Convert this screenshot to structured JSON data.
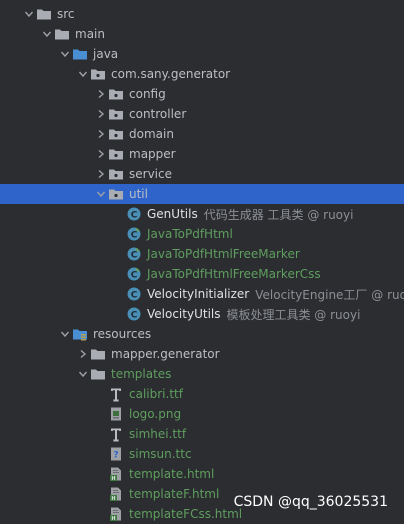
{
  "rows": [
    {
      "id": "src",
      "label": "src",
      "icon": "folder-icon",
      "expanded": true,
      "hasArrow": true,
      "indent": 0
    },
    {
      "id": "main",
      "label": "main",
      "icon": "folder-icon",
      "expanded": true,
      "hasArrow": true,
      "indent": 1
    },
    {
      "id": "java",
      "label": "java",
      "icon": "source-folder-icon",
      "expanded": true,
      "hasArrow": true,
      "indent": 2
    },
    {
      "id": "com-sany-generator",
      "label": "com.sany.generator",
      "icon": "package-icon",
      "expanded": true,
      "hasArrow": true,
      "indent": 3
    },
    {
      "id": "config",
      "label": "config",
      "icon": "package-icon",
      "expanded": false,
      "hasArrow": true,
      "indent": 4
    },
    {
      "id": "controller",
      "label": "controller",
      "icon": "package-icon",
      "expanded": false,
      "hasArrow": true,
      "indent": 4
    },
    {
      "id": "domain",
      "label": "domain",
      "icon": "package-icon",
      "expanded": false,
      "hasArrow": true,
      "indent": 4
    },
    {
      "id": "mapper",
      "label": "mapper",
      "icon": "package-icon",
      "expanded": false,
      "hasArrow": true,
      "indent": 4
    },
    {
      "id": "service",
      "label": "service",
      "icon": "package-icon",
      "expanded": false,
      "hasArrow": true,
      "indent": 4
    },
    {
      "id": "util",
      "label": "util",
      "icon": "package-icon",
      "expanded": true,
      "hasArrow": true,
      "indent": 4,
      "selected": true
    },
    {
      "id": "genutils",
      "label": "GenUtils",
      "desc": "代码生成器 工具类 @ ruoyi",
      "icon": "java-class-icon",
      "hasArrow": false,
      "indent": 5,
      "tone": "white"
    },
    {
      "id": "javatopdfhtml",
      "label": "JavaToPdfHtml",
      "icon": "java-class-new-icon",
      "hasArrow": false,
      "indent": 5,
      "tone": "green"
    },
    {
      "id": "javatopdfhtmlfreemarker",
      "label": "JavaToPdfHtmlFreeMarker",
      "icon": "java-class-new-icon",
      "hasArrow": false,
      "indent": 5,
      "tone": "green"
    },
    {
      "id": "javatopdfhtmlfreemarkercss",
      "label": "JavaToPdfHtmlFreeMarkerCss",
      "icon": "java-class-new-icon",
      "hasArrow": false,
      "indent": 5,
      "tone": "green"
    },
    {
      "id": "velocityinitializer",
      "label": "VelocityInitializer",
      "desc": "VelocityEngine工厂 @ ruoyi",
      "icon": "java-class-icon",
      "hasArrow": false,
      "indent": 5,
      "tone": "white"
    },
    {
      "id": "velocityutils",
      "label": "VelocityUtils",
      "desc": "模板处理工具类 @ ruoyi",
      "icon": "java-class-icon",
      "hasArrow": false,
      "indent": 5,
      "tone": "white"
    },
    {
      "id": "resources",
      "label": "resources",
      "icon": "resources-folder-icon",
      "expanded": true,
      "hasArrow": true,
      "indent": 2
    },
    {
      "id": "mapper-generator",
      "label": "mapper.generator",
      "icon": "folder-icon",
      "expanded": false,
      "hasArrow": true,
      "indent": 3
    },
    {
      "id": "templates",
      "label": "templates",
      "icon": "folder-icon",
      "expanded": true,
      "hasArrow": true,
      "indent": 3,
      "tone": "green"
    },
    {
      "id": "calibri",
      "label": "calibri.ttf",
      "icon": "font-file-icon",
      "hasArrow": false,
      "indent": 4,
      "tone": "green"
    },
    {
      "id": "logo",
      "label": "logo.png",
      "icon": "image-file-icon",
      "hasArrow": false,
      "indent": 4,
      "tone": "green"
    },
    {
      "id": "simhei",
      "label": "simhei.ttf",
      "icon": "font-file-icon",
      "hasArrow": false,
      "indent": 4,
      "tone": "green"
    },
    {
      "id": "simsun",
      "label": "simsun.ttc",
      "icon": "unknown-file-icon",
      "hasArrow": false,
      "indent": 4,
      "tone": "green"
    },
    {
      "id": "template-html",
      "label": "template.html",
      "icon": "html-file-icon",
      "hasArrow": false,
      "indent": 4,
      "tone": "green"
    },
    {
      "id": "templatef-html",
      "label": "templateF.html",
      "icon": "html-file-icon",
      "hasArrow": false,
      "indent": 4,
      "tone": "green"
    },
    {
      "id": "templatefcss-html",
      "label": "templateFCss.html",
      "icon": "html-file-icon",
      "hasArrow": false,
      "indent": 4,
      "tone": "green"
    }
  ],
  "watermark": "CSDN @qq_36025531",
  "colors": {
    "background": "#2b2d30",
    "selection": "#2f65ca",
    "folder": "#a9adb3",
    "sourceFolder": "#4a8fd6",
    "resourcesFolder": "#b49c52",
    "classCircle": "#4a8fb5",
    "classNewAccent": "#5f9e5f",
    "greenText": "#5f9e5f"
  }
}
